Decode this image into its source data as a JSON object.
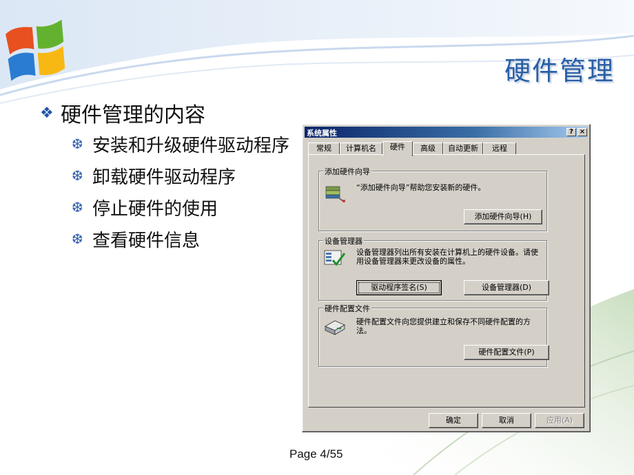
{
  "slide": {
    "title": "硬件管理",
    "bullet_main": "硬件管理的内容",
    "bullet_main_marker": "❖",
    "sub_marker": "❆",
    "sub_bullets": [
      "安装和升级硬件驱动程序",
      "卸载硬件驱动程序",
      "停止硬件的使用",
      "查看硬件信息"
    ],
    "page_label": "Page 4/55",
    "colors": {
      "title": "#2a5fa5",
      "marker": "#2356a8"
    }
  },
  "dialog": {
    "title": "系统属性",
    "help_label": "?",
    "close_label": "×",
    "tabs": [
      "常规",
      "计算机名",
      "硬件",
      "高级",
      "自动更新",
      "远程"
    ],
    "active_tab": "硬件",
    "groups": {
      "wizard": {
        "title": "添加硬件向导",
        "text": "“添加硬件向导”帮助您安装新的硬件。",
        "button": "添加硬件向导(H)",
        "icon": "add-hardware-icon"
      },
      "device_manager": {
        "title": "设备管理器",
        "text": "设备管理器列出所有安装在计算机上的硬件设备。请使用设备管理器来更改设备的属性。",
        "button_left": "驱动程序签名(S)",
        "button_right": "设备管理器(D)",
        "icon": "device-manager-icon"
      },
      "profiles": {
        "title": "硬件配置文件",
        "text": "硬件配置文件向您提供建立和保存不同硬件配置的方法。",
        "button": "硬件配置文件(P)",
        "icon": "hardware-profile-icon"
      }
    },
    "footer": {
      "ok": "确定",
      "cancel": "取消",
      "apply": "应用(A)"
    }
  }
}
